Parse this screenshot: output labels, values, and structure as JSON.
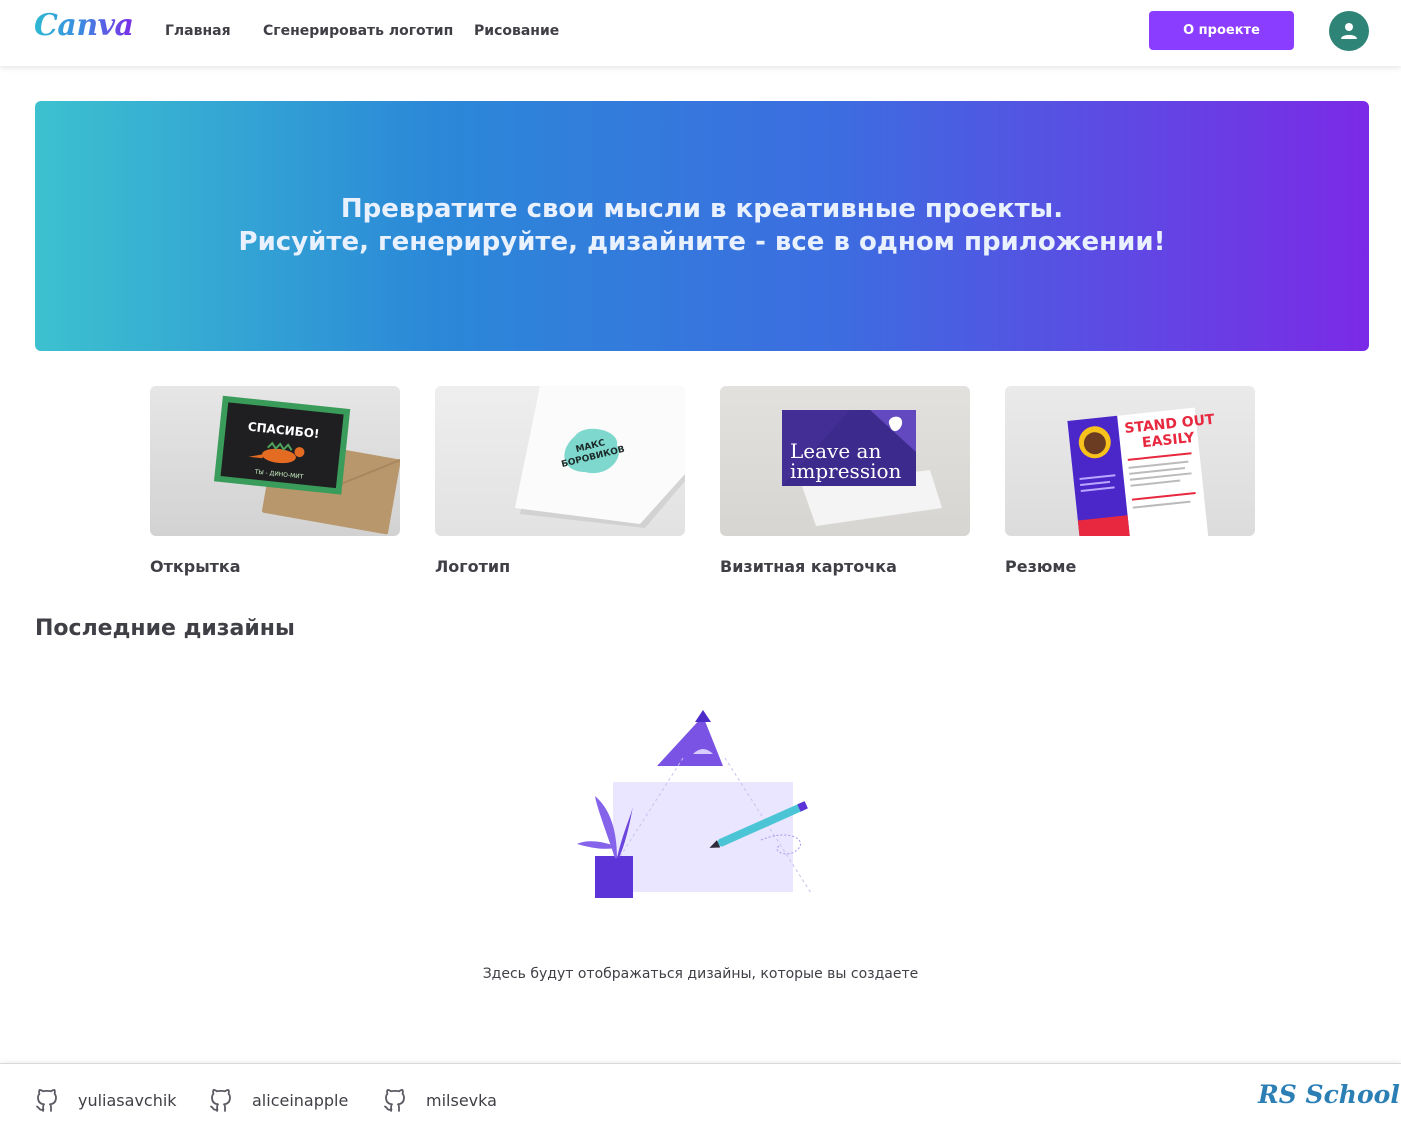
{
  "header": {
    "logo_text": "Canva",
    "nav": [
      {
        "label": "Главная"
      },
      {
        "label": "Сгенерировать логотип"
      },
      {
        "label": "Рисование"
      }
    ],
    "about_button": "О проекте",
    "avatar_icon": "user-icon"
  },
  "banner": {
    "line1": "Превратите свои мысли в креативные проекты.",
    "line2": "Рисуйте, генерируйте, дизайните - все в одном приложении!"
  },
  "templates": [
    {
      "label": "Открытка",
      "image_text": [
        "СПАСИБО!",
        "ТЫ - ДИНО-МИТ"
      ]
    },
    {
      "label": "Логотип",
      "image_text": [
        "МАКС",
        "БОРОВИКОВ"
      ]
    },
    {
      "label": "Визитная карточка",
      "image_text": [
        "Leave an",
        "impression"
      ]
    },
    {
      "label": "Резюме",
      "image_text": [
        "STAND OUT",
        "EASILY"
      ]
    }
  ],
  "recent": {
    "title": "Последние дизайны",
    "empty_text": "Здесь будут отображаться дизайны, которые вы создаете"
  },
  "footer": {
    "authors": [
      {
        "name": "yuliasavchik",
        "icon": "github-icon"
      },
      {
        "name": "aliceinapple",
        "icon": "github-icon"
      },
      {
        "name": "milsevka",
        "icon": "github-icon"
      }
    ],
    "school": "RS School"
  },
  "colors": {
    "accent": "#8b3dff",
    "avatar": "#2e8577",
    "banner_start": "#3cc1cf",
    "banner_end": "#7b2ae6"
  }
}
